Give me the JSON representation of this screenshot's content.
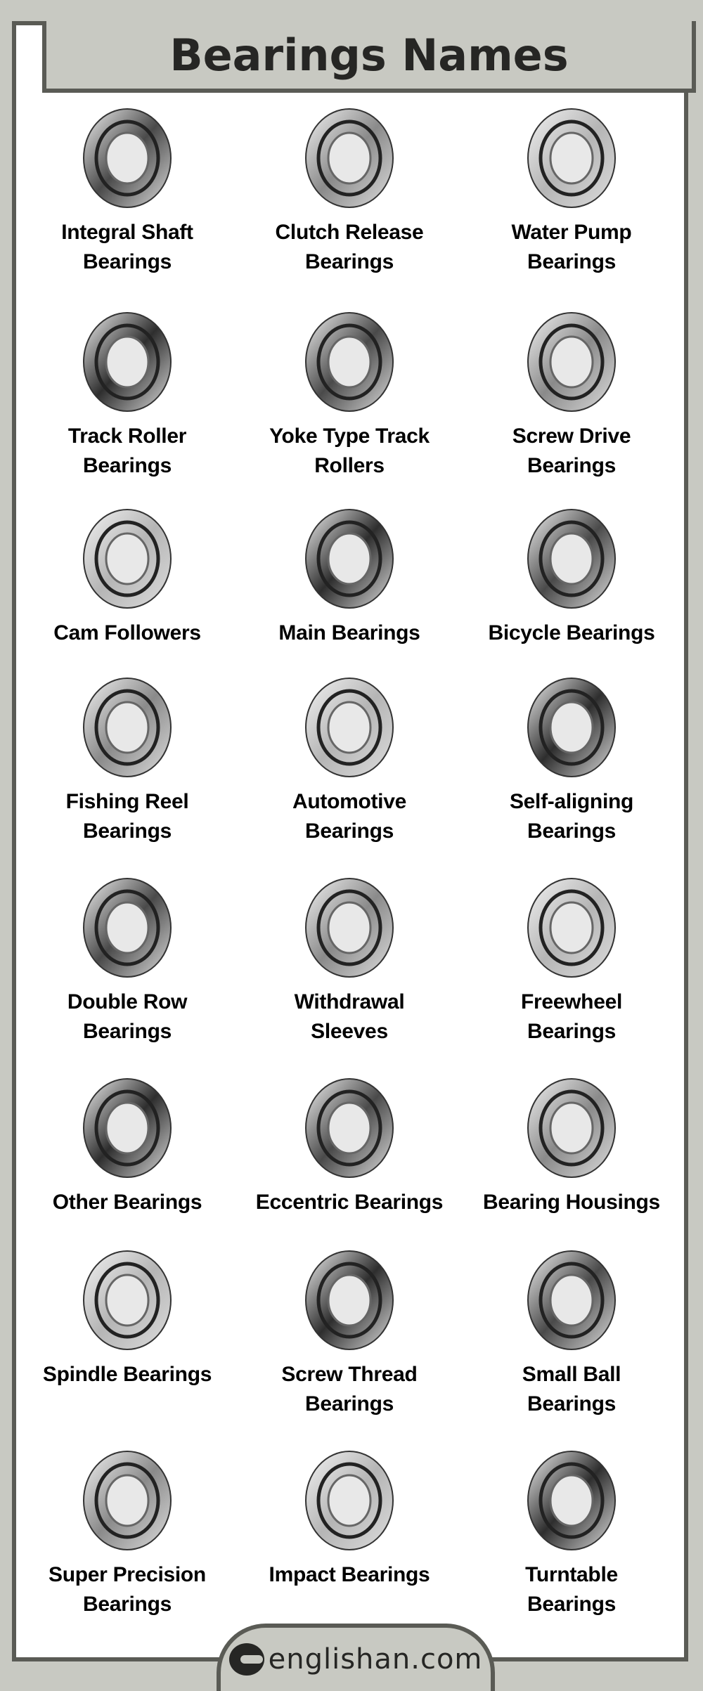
{
  "title": "Bearings Names",
  "items": [
    {
      "label": "Integral Shaft\nBearings",
      "icon": "integral-shaft-bearing-icon"
    },
    {
      "label": "Clutch Release\nBearings",
      "icon": "clutch-release-bearing-icon"
    },
    {
      "label": "Water Pump\nBearings",
      "icon": "water-pump-bearing-icon"
    },
    {
      "label": "Track Roller\nBearings",
      "icon": "track-roller-bearing-icon"
    },
    {
      "label": "Yoke Type Track\nRollers",
      "icon": "yoke-type-track-roller-icon"
    },
    {
      "label": "Screw Drive\nBearings",
      "icon": "screw-drive-bearing-icon"
    },
    {
      "label": "Cam Followers",
      "icon": "cam-follower-icon"
    },
    {
      "label": "Main Bearings",
      "icon": "main-bearing-icon"
    },
    {
      "label": "Bicycle Bearings",
      "icon": "bicycle-bearing-icon"
    },
    {
      "label": "Fishing Reel\nBearings",
      "icon": "fishing-reel-bearing-icon"
    },
    {
      "label": "Automotive\nBearings",
      "icon": "automotive-bearing-icon"
    },
    {
      "label": "Self-aligning\nBearings",
      "icon": "self-aligning-bearing-icon"
    },
    {
      "label": "Double Row\nBearings",
      "icon": "double-row-bearing-icon"
    },
    {
      "label": "Withdrawal\nSleeves",
      "icon": "withdrawal-sleeve-icon"
    },
    {
      "label": "Freewheel\nBearings",
      "icon": "freewheel-bearing-icon"
    },
    {
      "label": "Other Bearings",
      "icon": "other-bearing-icon"
    },
    {
      "label": "Eccentric Bearings",
      "icon": "eccentric-bearing-icon"
    },
    {
      "label": "Bearing Housings",
      "icon": "bearing-housing-icon"
    },
    {
      "label": "Spindle Bearings",
      "icon": "spindle-bearing-icon"
    },
    {
      "label": "Screw Thread\nBearings",
      "icon": "screw-thread-bearing-icon"
    },
    {
      "label": "Small Ball\nBearings",
      "icon": "small-ball-bearing-icon"
    },
    {
      "label": "Super Precision\nBearings",
      "icon": "super-precision-bearing-icon"
    },
    {
      "label": "Impact Bearings",
      "icon": "impact-bearing-icon"
    },
    {
      "label": "Turntable\nBearings",
      "icon": "turntable-bearing-icon"
    }
  ],
  "footer": {
    "site": "englishan.com",
    "logo_icon": "englishan-logo-icon"
  },
  "colors": {
    "background": "#c8c9c2",
    "border": "#5a5b55",
    "panel": "#ffffff",
    "text": "#262624"
  }
}
